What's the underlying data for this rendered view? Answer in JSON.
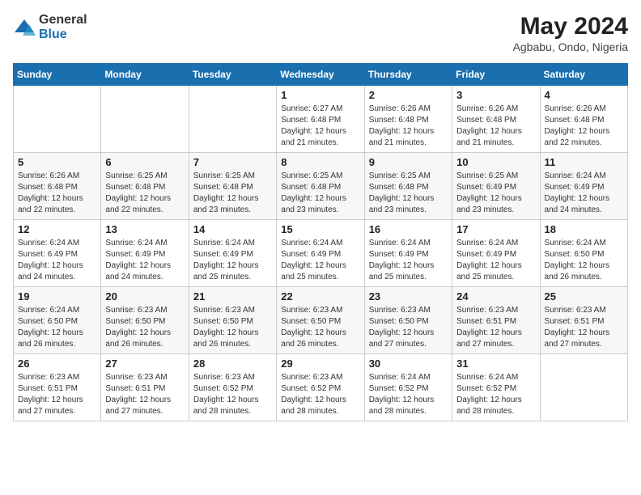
{
  "header": {
    "logo_general": "General",
    "logo_blue": "Blue",
    "title": "May 2024",
    "subtitle": "Agbabu, Ondo, Nigeria"
  },
  "calendar": {
    "days_of_week": [
      "Sunday",
      "Monday",
      "Tuesday",
      "Wednesday",
      "Thursday",
      "Friday",
      "Saturday"
    ],
    "weeks": [
      [
        {
          "day": "",
          "info": ""
        },
        {
          "day": "",
          "info": ""
        },
        {
          "day": "",
          "info": ""
        },
        {
          "day": "1",
          "info": "Sunrise: 6:27 AM\nSunset: 6:48 PM\nDaylight: 12 hours and 21 minutes."
        },
        {
          "day": "2",
          "info": "Sunrise: 6:26 AM\nSunset: 6:48 PM\nDaylight: 12 hours and 21 minutes."
        },
        {
          "day": "3",
          "info": "Sunrise: 6:26 AM\nSunset: 6:48 PM\nDaylight: 12 hours and 21 minutes."
        },
        {
          "day": "4",
          "info": "Sunrise: 6:26 AM\nSunset: 6:48 PM\nDaylight: 12 hours and 22 minutes."
        }
      ],
      [
        {
          "day": "5",
          "info": "Sunrise: 6:26 AM\nSunset: 6:48 PM\nDaylight: 12 hours and 22 minutes."
        },
        {
          "day": "6",
          "info": "Sunrise: 6:25 AM\nSunset: 6:48 PM\nDaylight: 12 hours and 22 minutes."
        },
        {
          "day": "7",
          "info": "Sunrise: 6:25 AM\nSunset: 6:48 PM\nDaylight: 12 hours and 23 minutes."
        },
        {
          "day": "8",
          "info": "Sunrise: 6:25 AM\nSunset: 6:48 PM\nDaylight: 12 hours and 23 minutes."
        },
        {
          "day": "9",
          "info": "Sunrise: 6:25 AM\nSunset: 6:48 PM\nDaylight: 12 hours and 23 minutes."
        },
        {
          "day": "10",
          "info": "Sunrise: 6:25 AM\nSunset: 6:49 PM\nDaylight: 12 hours and 23 minutes."
        },
        {
          "day": "11",
          "info": "Sunrise: 6:24 AM\nSunset: 6:49 PM\nDaylight: 12 hours and 24 minutes."
        }
      ],
      [
        {
          "day": "12",
          "info": "Sunrise: 6:24 AM\nSunset: 6:49 PM\nDaylight: 12 hours and 24 minutes."
        },
        {
          "day": "13",
          "info": "Sunrise: 6:24 AM\nSunset: 6:49 PM\nDaylight: 12 hours and 24 minutes."
        },
        {
          "day": "14",
          "info": "Sunrise: 6:24 AM\nSunset: 6:49 PM\nDaylight: 12 hours and 25 minutes."
        },
        {
          "day": "15",
          "info": "Sunrise: 6:24 AM\nSunset: 6:49 PM\nDaylight: 12 hours and 25 minutes."
        },
        {
          "day": "16",
          "info": "Sunrise: 6:24 AM\nSunset: 6:49 PM\nDaylight: 12 hours and 25 minutes."
        },
        {
          "day": "17",
          "info": "Sunrise: 6:24 AM\nSunset: 6:49 PM\nDaylight: 12 hours and 25 minutes."
        },
        {
          "day": "18",
          "info": "Sunrise: 6:24 AM\nSunset: 6:50 PM\nDaylight: 12 hours and 26 minutes."
        }
      ],
      [
        {
          "day": "19",
          "info": "Sunrise: 6:24 AM\nSunset: 6:50 PM\nDaylight: 12 hours and 26 minutes."
        },
        {
          "day": "20",
          "info": "Sunrise: 6:23 AM\nSunset: 6:50 PM\nDaylight: 12 hours and 26 minutes."
        },
        {
          "day": "21",
          "info": "Sunrise: 6:23 AM\nSunset: 6:50 PM\nDaylight: 12 hours and 26 minutes."
        },
        {
          "day": "22",
          "info": "Sunrise: 6:23 AM\nSunset: 6:50 PM\nDaylight: 12 hours and 26 minutes."
        },
        {
          "day": "23",
          "info": "Sunrise: 6:23 AM\nSunset: 6:50 PM\nDaylight: 12 hours and 27 minutes."
        },
        {
          "day": "24",
          "info": "Sunrise: 6:23 AM\nSunset: 6:51 PM\nDaylight: 12 hours and 27 minutes."
        },
        {
          "day": "25",
          "info": "Sunrise: 6:23 AM\nSunset: 6:51 PM\nDaylight: 12 hours and 27 minutes."
        }
      ],
      [
        {
          "day": "26",
          "info": "Sunrise: 6:23 AM\nSunset: 6:51 PM\nDaylight: 12 hours and 27 minutes."
        },
        {
          "day": "27",
          "info": "Sunrise: 6:23 AM\nSunset: 6:51 PM\nDaylight: 12 hours and 27 minutes."
        },
        {
          "day": "28",
          "info": "Sunrise: 6:23 AM\nSunset: 6:52 PM\nDaylight: 12 hours and 28 minutes."
        },
        {
          "day": "29",
          "info": "Sunrise: 6:23 AM\nSunset: 6:52 PM\nDaylight: 12 hours and 28 minutes."
        },
        {
          "day": "30",
          "info": "Sunrise: 6:24 AM\nSunset: 6:52 PM\nDaylight: 12 hours and 28 minutes."
        },
        {
          "day": "31",
          "info": "Sunrise: 6:24 AM\nSunset: 6:52 PM\nDaylight: 12 hours and 28 minutes."
        },
        {
          "day": "",
          "info": ""
        }
      ]
    ]
  }
}
